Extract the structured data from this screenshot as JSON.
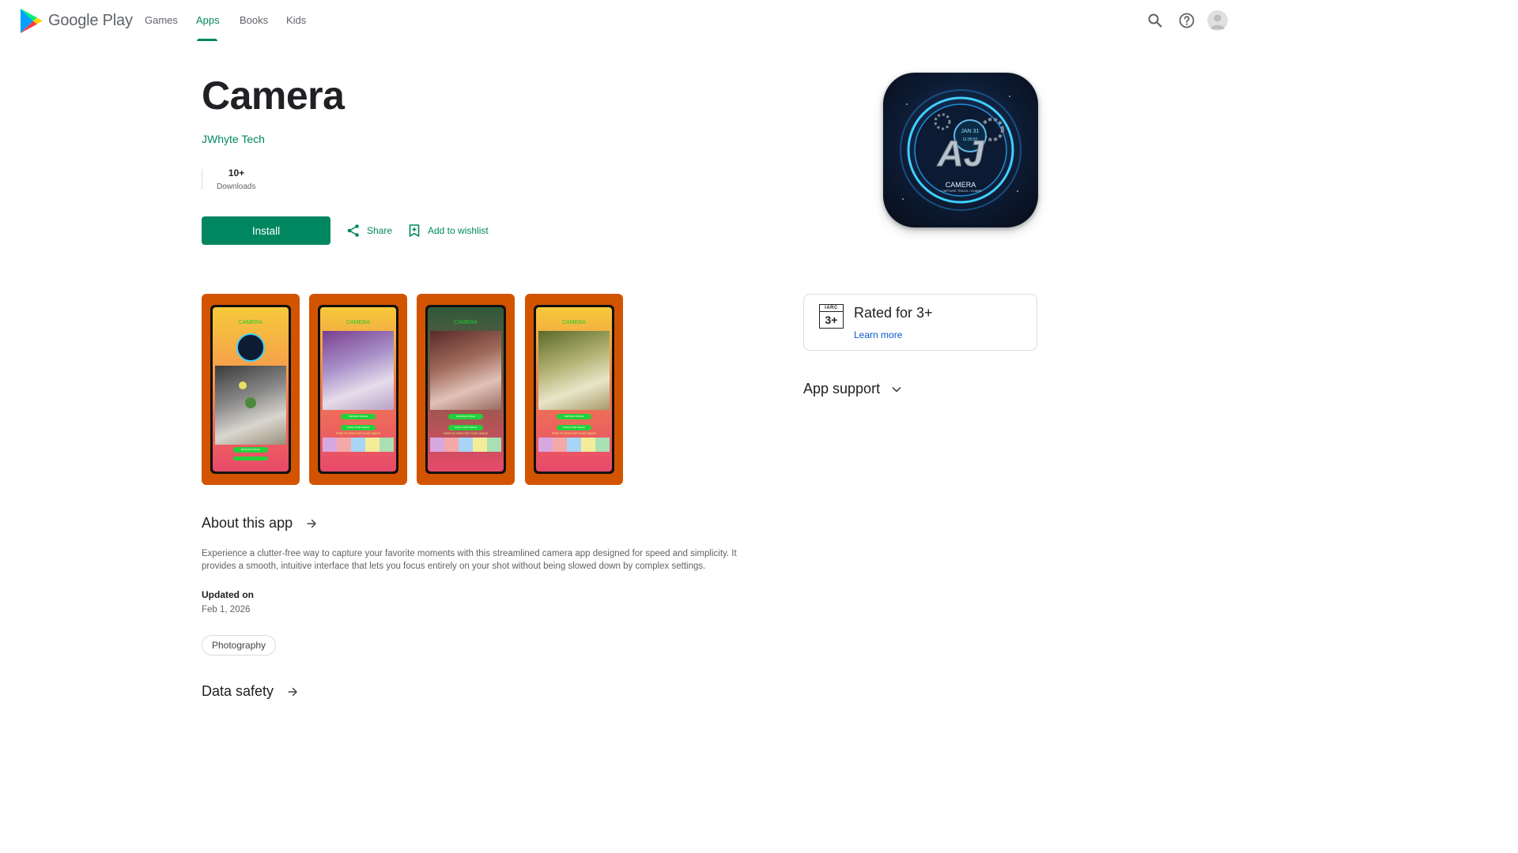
{
  "header": {
    "logo_text": "Google Play",
    "nav": [
      {
        "label": "Games"
      },
      {
        "label": "Apps"
      },
      {
        "label": "Books"
      },
      {
        "label": "Kids"
      }
    ]
  },
  "app": {
    "title": "Camera",
    "developer": "JWhyte Tech",
    "downloads_value": "10+",
    "downloads_label": "Downloads",
    "install_label": "Install",
    "share_label": "Share",
    "wishlist_label": "Add to wishlist",
    "icon_text": {
      "monogram": "AJ",
      "name": "CAMERA",
      "tagline": "• CAPTURE TRACK • SHARE",
      "date": "JAN 31",
      "time": "11:35:52"
    }
  },
  "screenshots": [
    {
      "app_title": "CAMERA",
      "button1": "REDRAW IMAGE",
      "filters_text": ""
    },
    {
      "app_title": "CAMERA",
      "button1": "REDRAW IMAGE",
      "button2": "SAVE YOUR IMAGE",
      "filters_text": "FREE FILTERS FOR YOUR IMAGE"
    },
    {
      "app_title": "CAMERA",
      "button1": "REDRAW IMAGE",
      "button2": "SAVE YOUR IMAGE",
      "filters_text": "FREE FILTERS FOR YOUR IMAGE"
    },
    {
      "app_title": "CAMERA",
      "button1": "REDRAW IMAGE",
      "button2": "SAVE YOUR IMAGE",
      "filters_text": "FREE FILTERS FOR YOUR IMAGE"
    }
  ],
  "rating": {
    "badge_top": "IARC",
    "badge_value": "3+",
    "text": "Rated for 3+",
    "learn_more": "Learn more"
  },
  "support": {
    "title": "App support"
  },
  "about": {
    "title": "About this app",
    "description": "Experience a clutter-free way to capture your favorite moments with this streamlined camera app designed for speed and simplicity. It provides a smooth, intuitive interface that lets you focus entirely on your shot without being slowed down by complex settings.",
    "updated_label": "Updated on",
    "updated_value": "Feb 1, 2026",
    "category": "Photography"
  },
  "data_safety": {
    "title": "Data safety"
  },
  "colors": {
    "accent": "#01875f",
    "link_blue": "#0b57d0",
    "screenshot_bg": "#d35400"
  }
}
